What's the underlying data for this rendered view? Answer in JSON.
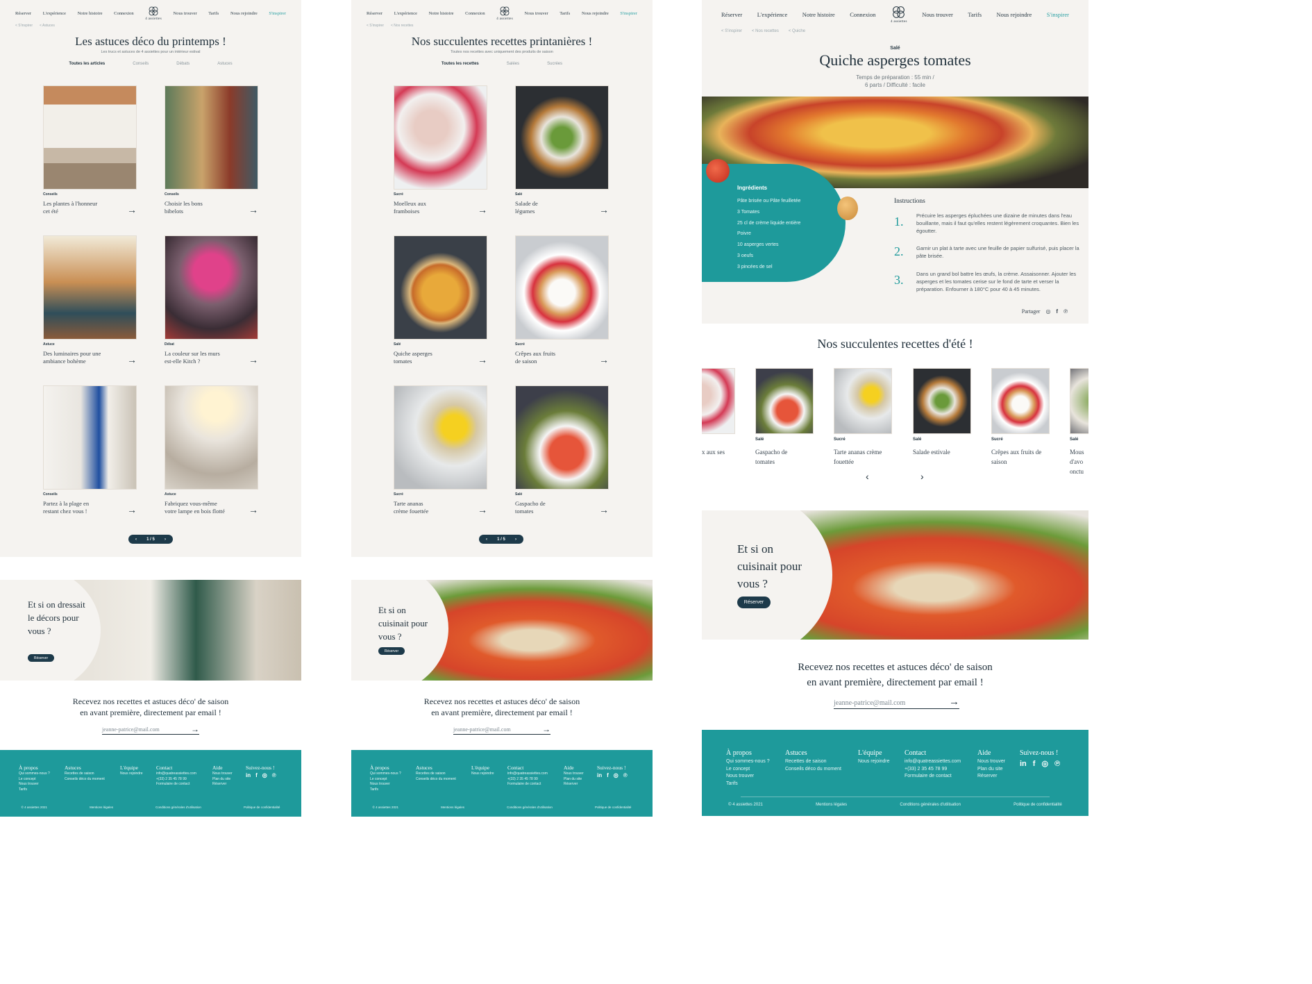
{
  "nav": {
    "items": [
      "Réserver",
      "L'expérience",
      "Notre histoire",
      "Connexion",
      "Nous trouver",
      "Tarifs",
      "Nous rejoindre"
    ],
    "active": "S'inspirer",
    "logo_text": "4 assiettes"
  },
  "page1": {
    "breadcrumb": [
      "< S'inspirer",
      "< Astuces"
    ],
    "title": "Les astuces déco du printemps !",
    "subtitle": "Les trucs et astuces de 4 assiettes pour un intérieur estival",
    "filters": [
      "Toutes les articles",
      "Conseils",
      "Débats",
      "Astuces"
    ],
    "cards": [
      {
        "tag": "Conseils",
        "title": "Les plantes à l'honneur cet été"
      },
      {
        "tag": "Conseils",
        "title": "Choisir les bons bibelots"
      },
      {
        "tag": "Astuce",
        "title": "Des luminaires pour une ambiance bohème"
      },
      {
        "tag": "Débat",
        "title": "La couleur sur les murs est-elle Kitch ?"
      },
      {
        "tag": "Conseils",
        "title": "Partez à la plage en restant chez vous !"
      },
      {
        "tag": "Astuce",
        "title": "Fabriquez vous-même votre lampe en bois flotté"
      }
    ],
    "pager": "1 / 5",
    "promo": "Et si on dressait le décors pour vous ?",
    "promo_btn": "Réserver"
  },
  "page2": {
    "breadcrumb": [
      "< S'inspirer",
      "< Nos recettes"
    ],
    "title": "Nos succulentes recettes printanières !",
    "subtitle": "Toutes nos recettes avec uniquement des produits de saison",
    "filters": [
      "Toutes les recettes",
      "Salées",
      "Sucrées"
    ],
    "cards": [
      {
        "tag": "Sucré",
        "title": "Moelleux aux framboises"
      },
      {
        "tag": "Salé",
        "title": "Salade de légumes"
      },
      {
        "tag": "Salé",
        "title": "Quiche asperges tomates"
      },
      {
        "tag": "Sucré",
        "title": "Crêpes aux fruits de saison"
      },
      {
        "tag": "Sucré",
        "title": "Tarte ananas crème fouettée"
      },
      {
        "tag": "Salé",
        "title": "Gaspacho de tomates"
      }
    ],
    "pager": "1 / 5",
    "promo": "Et si on cuisinait pour vous ?",
    "promo_btn": "Réserver"
  },
  "page3": {
    "breadcrumb": [
      "< S'inspirer",
      "< Nos recettes",
      "< Quiche"
    ],
    "tag": "Salé",
    "title": "Quiche asperges tomates",
    "meta1": "Temps de préparation : 55 min  /",
    "meta2": "6 parts / Difficulté : facile",
    "ingredients_title": "Ingrédients",
    "ingredients": [
      "Pâte brisée ou Pâte feuilletée",
      "3 Tomates",
      "25 cl de crème liquide entière",
      "Poivre",
      "10 asperges vertes",
      "3 oeufs",
      "3 pincées de sel"
    ],
    "instructions_title": "Instructions",
    "steps": [
      {
        "num": "1.",
        "text": "Précuire les asperges épluchées une dizaine de minutes dans l'eau bouillante, mais il faut qu'elles restent légèrement croquantes. Bien les égoutter."
      },
      {
        "num": "2.",
        "text": "Garnir un plat à tarte avec une feuille de papier sulfurisé, puis placer la pâte brisée."
      },
      {
        "num": "3.",
        "text": "Dans un grand bol battre les œufs, la crème. Assaisonner. Ajouter les asperges et les tomates cerise sur le fond de tarte et verser la préparation. Enfourner à 180°C pour 40 à 45 minutes."
      }
    ],
    "share": "Partager",
    "summer_title": "Nos succulentes recettes d'été !",
    "carousel": [
      {
        "tag": "",
        "title": "x aux ses"
      },
      {
        "tag": "Salé",
        "title": "Gaspacho de tomates"
      },
      {
        "tag": "Sucré",
        "title": "Tarte ananas crème fouettée"
      },
      {
        "tag": "Salé",
        "title": "Salade estivale"
      },
      {
        "tag": "Sucré",
        "title": "Crêpes aux fruits de saison"
      },
      {
        "tag": "Salé",
        "title": "Mous d'avo onctu"
      }
    ],
    "promo": "Et si on cuisinait pour vous ?",
    "promo_btn": "Réserver"
  },
  "newsletter": {
    "line1": "Recevez nos recettes et astuces déco' de saison",
    "line2": "en avant première, directement par email !",
    "email_placeholder": "jeanne-patrice@mail.com"
  },
  "footer": {
    "cols": [
      {
        "h": "À propos",
        "items": [
          "Qui sommes-nous ?",
          "Le concept",
          "Nous trouver",
          "Tarifs"
        ]
      },
      {
        "h": "Astuces",
        "items": [
          "Recettes de saison",
          "Conseils déco du moment"
        ]
      },
      {
        "h": "L'équipe",
        "items": [
          "Nous rejoindre"
        ]
      },
      {
        "h": "Contact",
        "items": [
          "info@quatreassiettes.com",
          "+(33) 2 35 45 78 99",
          "Formulaire de contact"
        ]
      },
      {
        "h": "Aide",
        "items": [
          "Nous trouver",
          "Plan du site",
          "Réserver"
        ]
      },
      {
        "h": "Suivez-nous !",
        "items": []
      }
    ],
    "legal": [
      "© 4 assiettes 2021",
      "Mentions légales",
      "Conditions générales d'utilisation",
      "Politique de confidentialité"
    ]
  },
  "colors": {
    "teal": "#1e9a9b",
    "navy": "#1d3a4a",
    "cream": "#f5f3f0"
  }
}
